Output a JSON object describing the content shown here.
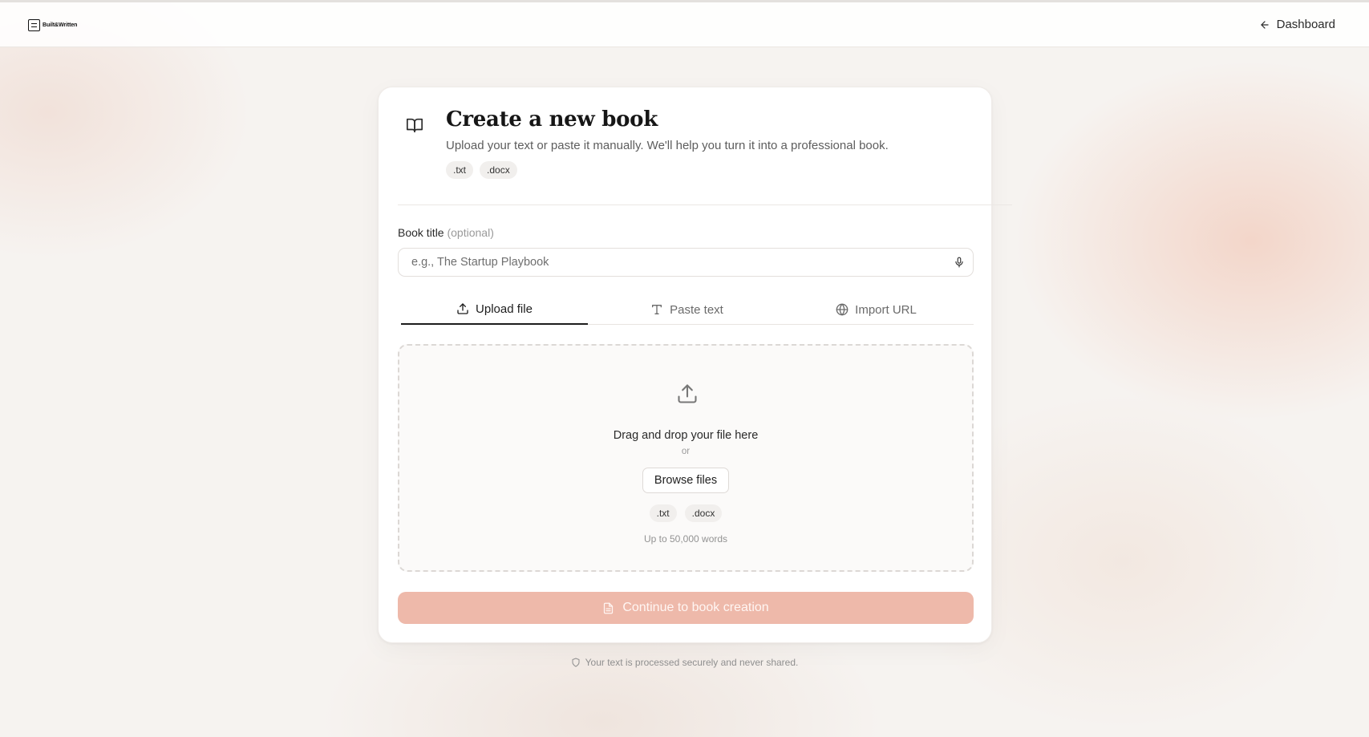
{
  "header": {
    "logo_text": "Built&Written",
    "dashboard_label": "Dashboard"
  },
  "card": {
    "title": "Create a new book",
    "subtitle": "Upload your text or paste it manually. We'll help you turn it into a professional book.",
    "formats": [
      ".txt",
      ".docx"
    ],
    "title_field": {
      "label": "Book title",
      "optional": "(optional)",
      "placeholder": "e.g., The Startup Playbook",
      "value": ""
    },
    "tabs": [
      {
        "label": "Upload file",
        "icon": "upload-icon",
        "active": true
      },
      {
        "label": "Paste text",
        "icon": "text-icon",
        "active": false
      },
      {
        "label": "Import URL",
        "icon": "globe-icon",
        "active": false
      }
    ],
    "dropzone": {
      "main_text": "Drag and drop your file here",
      "or_text": "or",
      "browse_label": "Browse files",
      "formats": [
        ".txt",
        ".docx"
      ],
      "limit_text": "Up to 50,000 words"
    },
    "continue_label": "Continue to book creation"
  },
  "footer": {
    "note": "Your text is processed securely and never shared."
  },
  "colors": {
    "accent_disabled": "#eeb9aa",
    "background": "#f6f3f0"
  }
}
